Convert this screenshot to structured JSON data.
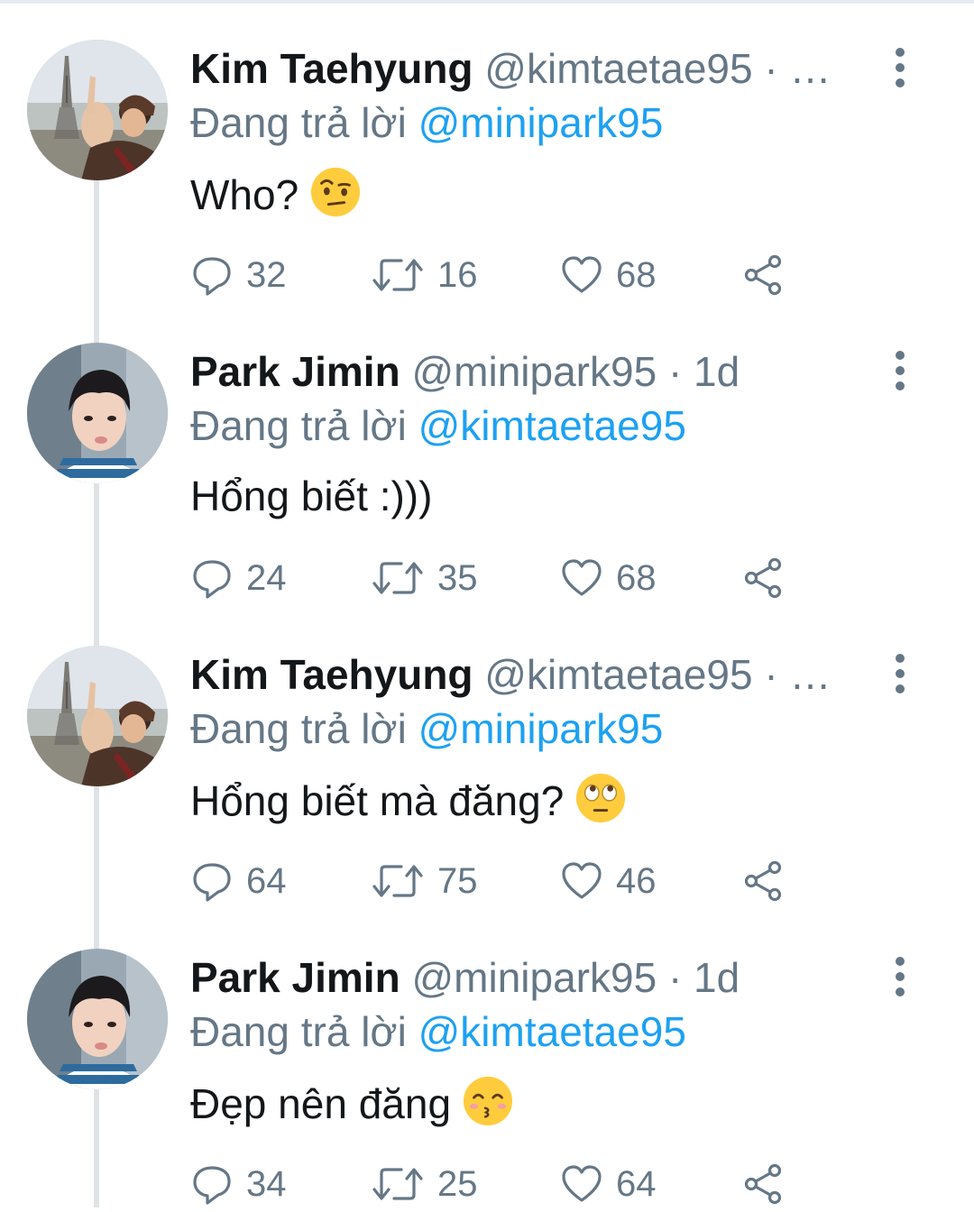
{
  "tweets": [
    {
      "name": "Kim Taehyung",
      "handle": "@kimtaetae95",
      "separator": "·",
      "time": "…",
      "reply_prefix": "Đang trả lời",
      "reply_to": "@minipark95",
      "text": "Who?",
      "emoji": "face-with-raised-eyebrow",
      "replies": "32",
      "retweets": "16",
      "likes": "68"
    },
    {
      "name": "Park Jimin",
      "handle": "@minipark95",
      "separator": "·",
      "time": "1d",
      "reply_prefix": "Đang trả lời",
      "reply_to": "@kimtaetae95",
      "text": "Hổng biết :)))",
      "emoji": "",
      "replies": "24",
      "retweets": "35",
      "likes": "68"
    },
    {
      "name": "Kim Taehyung",
      "handle": "@kimtaetae95",
      "separator": "·",
      "time": "…",
      "reply_prefix": "Đang trả lời",
      "reply_to": "@minipark95",
      "text": "Hổng biết mà đăng?",
      "emoji": "face-with-rolling-eyes",
      "replies": "64",
      "retweets": "75",
      "likes": "46"
    },
    {
      "name": "Park Jimin",
      "handle": "@minipark95",
      "separator": "·",
      "time": "1d",
      "reply_prefix": "Đang trả lời",
      "reply_to": "@kimtaetae95",
      "text": "Đẹp nên đăng",
      "emoji": "kissing-face-with-smiling-eyes",
      "replies": "34",
      "retweets": "25",
      "likes": "64"
    }
  ],
  "icons": {
    "reply": "speech-bubble-icon",
    "retweet": "retweet-arrows-icon",
    "like": "heart-icon",
    "share": "share-nodes-icon",
    "more": "vertical-ellipsis-icon"
  },
  "colors": {
    "text": "#14171a",
    "secondary": "#657786",
    "link": "#1da1f2",
    "thread_line": "#dfe3e6"
  }
}
